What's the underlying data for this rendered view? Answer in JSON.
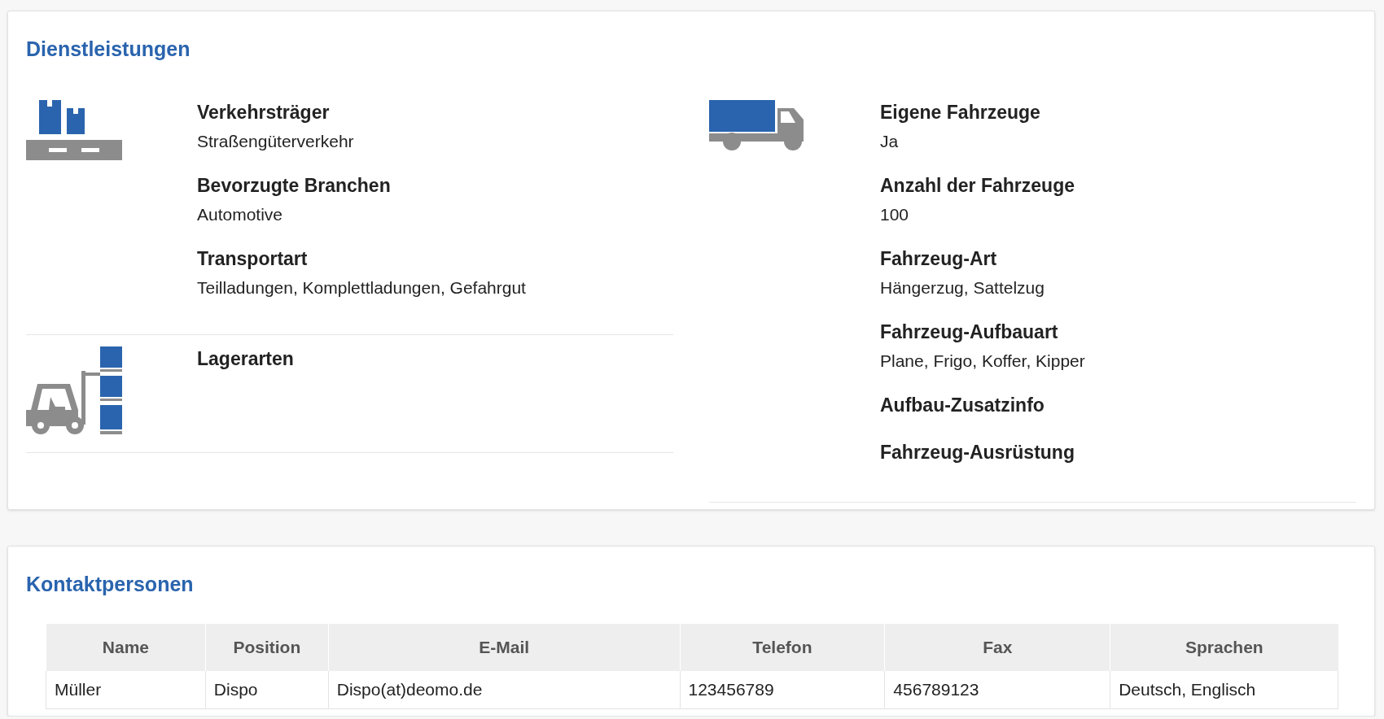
{
  "services": {
    "title": "Dienstleistungen",
    "columns": [
      {
        "groups": [
          {
            "kind": "pallet",
            "fields": [
              {
                "label": "Verkehrsträger",
                "value": "Straßengüterverkehr"
              },
              {
                "label": "Bevorzugte Branchen",
                "value": "Automotive"
              },
              {
                "label": "Transportart",
                "value": "Teilladungen, Komplettladungen, Gefahrgut"
              }
            ]
          },
          {
            "kind": "forklift",
            "fields": [
              {
                "label": "Lagerarten"
              }
            ]
          }
        ]
      },
      {
        "groups": [
          {
            "kind": "truck",
            "fields": [
              {
                "label": "Eigene Fahrzeuge",
                "value": "Ja"
              },
              {
                "label": "Anzahl der Fahrzeuge",
                "value": "100"
              },
              {
                "label": "Fahrzeug-Art",
                "value": "Hängerzug, Sattelzug"
              },
              {
                "label": "Fahrzeug-Aufbauart",
                "value": "Plane, Frigo, Koffer, Kipper"
              },
              {
                "label": "Aufbau-Zusatzinfo"
              },
              {
                "label": "Fahrzeug-Ausrüstung"
              }
            ]
          }
        ]
      }
    ]
  },
  "contacts": {
    "title": "Kontaktpersonen",
    "table": {
      "columns": [
        "Name",
        "Position",
        "E-Mail",
        "Telefon",
        "Fax",
        "Sprachen"
      ],
      "rows": [
        [
          "Müller",
          "Dispo",
          "Dispo(at)deomo.de",
          "123456789",
          "456789123",
          "Deutsch, Englisch"
        ]
      ]
    }
  }
}
